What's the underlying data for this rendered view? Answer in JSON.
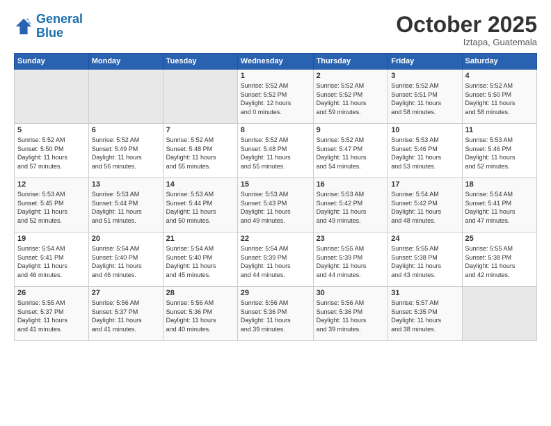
{
  "header": {
    "logo_line1": "General",
    "logo_line2": "Blue",
    "month": "October 2025",
    "location": "Iztapa, Guatemala"
  },
  "days_of_week": [
    "Sunday",
    "Monday",
    "Tuesday",
    "Wednesday",
    "Thursday",
    "Friday",
    "Saturday"
  ],
  "weeks": [
    [
      {
        "day": "",
        "info": ""
      },
      {
        "day": "",
        "info": ""
      },
      {
        "day": "",
        "info": ""
      },
      {
        "day": "1",
        "info": "Sunrise: 5:52 AM\nSunset: 5:52 PM\nDaylight: 12 hours\nand 0 minutes."
      },
      {
        "day": "2",
        "info": "Sunrise: 5:52 AM\nSunset: 5:52 PM\nDaylight: 11 hours\nand 59 minutes."
      },
      {
        "day": "3",
        "info": "Sunrise: 5:52 AM\nSunset: 5:51 PM\nDaylight: 11 hours\nand 58 minutes."
      },
      {
        "day": "4",
        "info": "Sunrise: 5:52 AM\nSunset: 5:50 PM\nDaylight: 11 hours\nand 58 minutes."
      }
    ],
    [
      {
        "day": "5",
        "info": "Sunrise: 5:52 AM\nSunset: 5:50 PM\nDaylight: 11 hours\nand 57 minutes."
      },
      {
        "day": "6",
        "info": "Sunrise: 5:52 AM\nSunset: 5:49 PM\nDaylight: 11 hours\nand 56 minutes."
      },
      {
        "day": "7",
        "info": "Sunrise: 5:52 AM\nSunset: 5:48 PM\nDaylight: 11 hours\nand 55 minutes."
      },
      {
        "day": "8",
        "info": "Sunrise: 5:52 AM\nSunset: 5:48 PM\nDaylight: 11 hours\nand 55 minutes."
      },
      {
        "day": "9",
        "info": "Sunrise: 5:52 AM\nSunset: 5:47 PM\nDaylight: 11 hours\nand 54 minutes."
      },
      {
        "day": "10",
        "info": "Sunrise: 5:53 AM\nSunset: 5:46 PM\nDaylight: 11 hours\nand 53 minutes."
      },
      {
        "day": "11",
        "info": "Sunrise: 5:53 AM\nSunset: 5:46 PM\nDaylight: 11 hours\nand 52 minutes."
      }
    ],
    [
      {
        "day": "12",
        "info": "Sunrise: 5:53 AM\nSunset: 5:45 PM\nDaylight: 11 hours\nand 52 minutes."
      },
      {
        "day": "13",
        "info": "Sunrise: 5:53 AM\nSunset: 5:44 PM\nDaylight: 11 hours\nand 51 minutes."
      },
      {
        "day": "14",
        "info": "Sunrise: 5:53 AM\nSunset: 5:44 PM\nDaylight: 11 hours\nand 50 minutes."
      },
      {
        "day": "15",
        "info": "Sunrise: 5:53 AM\nSunset: 5:43 PM\nDaylight: 11 hours\nand 49 minutes."
      },
      {
        "day": "16",
        "info": "Sunrise: 5:53 AM\nSunset: 5:42 PM\nDaylight: 11 hours\nand 49 minutes."
      },
      {
        "day": "17",
        "info": "Sunrise: 5:54 AM\nSunset: 5:42 PM\nDaylight: 11 hours\nand 48 minutes."
      },
      {
        "day": "18",
        "info": "Sunrise: 5:54 AM\nSunset: 5:41 PM\nDaylight: 11 hours\nand 47 minutes."
      }
    ],
    [
      {
        "day": "19",
        "info": "Sunrise: 5:54 AM\nSunset: 5:41 PM\nDaylight: 11 hours\nand 46 minutes."
      },
      {
        "day": "20",
        "info": "Sunrise: 5:54 AM\nSunset: 5:40 PM\nDaylight: 11 hours\nand 46 minutes."
      },
      {
        "day": "21",
        "info": "Sunrise: 5:54 AM\nSunset: 5:40 PM\nDaylight: 11 hours\nand 45 minutes."
      },
      {
        "day": "22",
        "info": "Sunrise: 5:54 AM\nSunset: 5:39 PM\nDaylight: 11 hours\nand 44 minutes."
      },
      {
        "day": "23",
        "info": "Sunrise: 5:55 AM\nSunset: 5:39 PM\nDaylight: 11 hours\nand 44 minutes."
      },
      {
        "day": "24",
        "info": "Sunrise: 5:55 AM\nSunset: 5:38 PM\nDaylight: 11 hours\nand 43 minutes."
      },
      {
        "day": "25",
        "info": "Sunrise: 5:55 AM\nSunset: 5:38 PM\nDaylight: 11 hours\nand 42 minutes."
      }
    ],
    [
      {
        "day": "26",
        "info": "Sunrise: 5:55 AM\nSunset: 5:37 PM\nDaylight: 11 hours\nand 41 minutes."
      },
      {
        "day": "27",
        "info": "Sunrise: 5:56 AM\nSunset: 5:37 PM\nDaylight: 11 hours\nand 41 minutes."
      },
      {
        "day": "28",
        "info": "Sunrise: 5:56 AM\nSunset: 5:36 PM\nDaylight: 11 hours\nand 40 minutes."
      },
      {
        "day": "29",
        "info": "Sunrise: 5:56 AM\nSunset: 5:36 PM\nDaylight: 11 hours\nand 39 minutes."
      },
      {
        "day": "30",
        "info": "Sunrise: 5:56 AM\nSunset: 5:36 PM\nDaylight: 11 hours\nand 39 minutes."
      },
      {
        "day": "31",
        "info": "Sunrise: 5:57 AM\nSunset: 5:35 PM\nDaylight: 11 hours\nand 38 minutes."
      },
      {
        "day": "",
        "info": ""
      }
    ]
  ]
}
